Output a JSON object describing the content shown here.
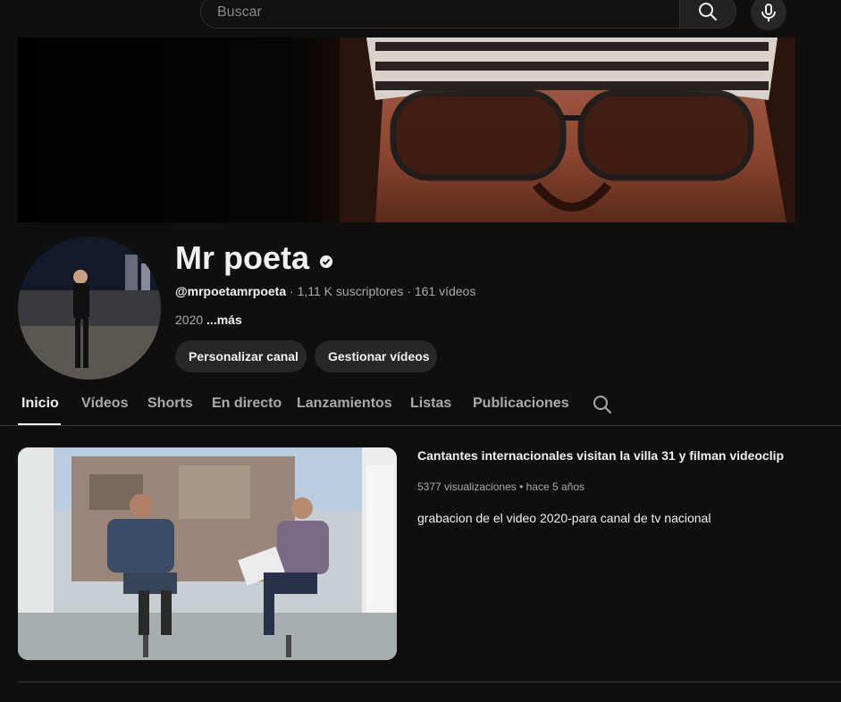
{
  "search": {
    "placeholder": "Buscar"
  },
  "icons": {
    "search": "search-icon",
    "mic": "microphone-icon",
    "verified": "verified-badge-icon",
    "tab_search": "search-icon"
  },
  "channel": {
    "name": "Mr poeta",
    "handle": "@mrpoetamrpoeta",
    "separator": " · ",
    "subscribers": "1,11 K suscriptores",
    "videos_count": "161 vídeos",
    "description": "2020",
    "more": "...más"
  },
  "buttons": {
    "customize": "Personalizar canal",
    "manage": "Gestionar vídeos"
  },
  "tabs": [
    {
      "label": "Inicio",
      "active": true
    },
    {
      "label": "Vídeos"
    },
    {
      "label": "Shorts"
    },
    {
      "label": "En directo"
    },
    {
      "label": "Lanzamientos"
    },
    {
      "label": "Listas"
    },
    {
      "label": "Publicaciones"
    }
  ],
  "featured_video": {
    "title": "Cantantes internacionales visitan la villa 31 y filman videoclip ...",
    "views": "5377 visualizaciones",
    "separator": " • ",
    "age": "hace 5 años",
    "description": "grabacion de el video 2020-para canal de tv nacional"
  },
  "colors": {
    "background": "#0f0f0f",
    "text_primary": "#f1f1f1",
    "text_secondary": "#aaaaaa",
    "button_bg": "#272727"
  }
}
